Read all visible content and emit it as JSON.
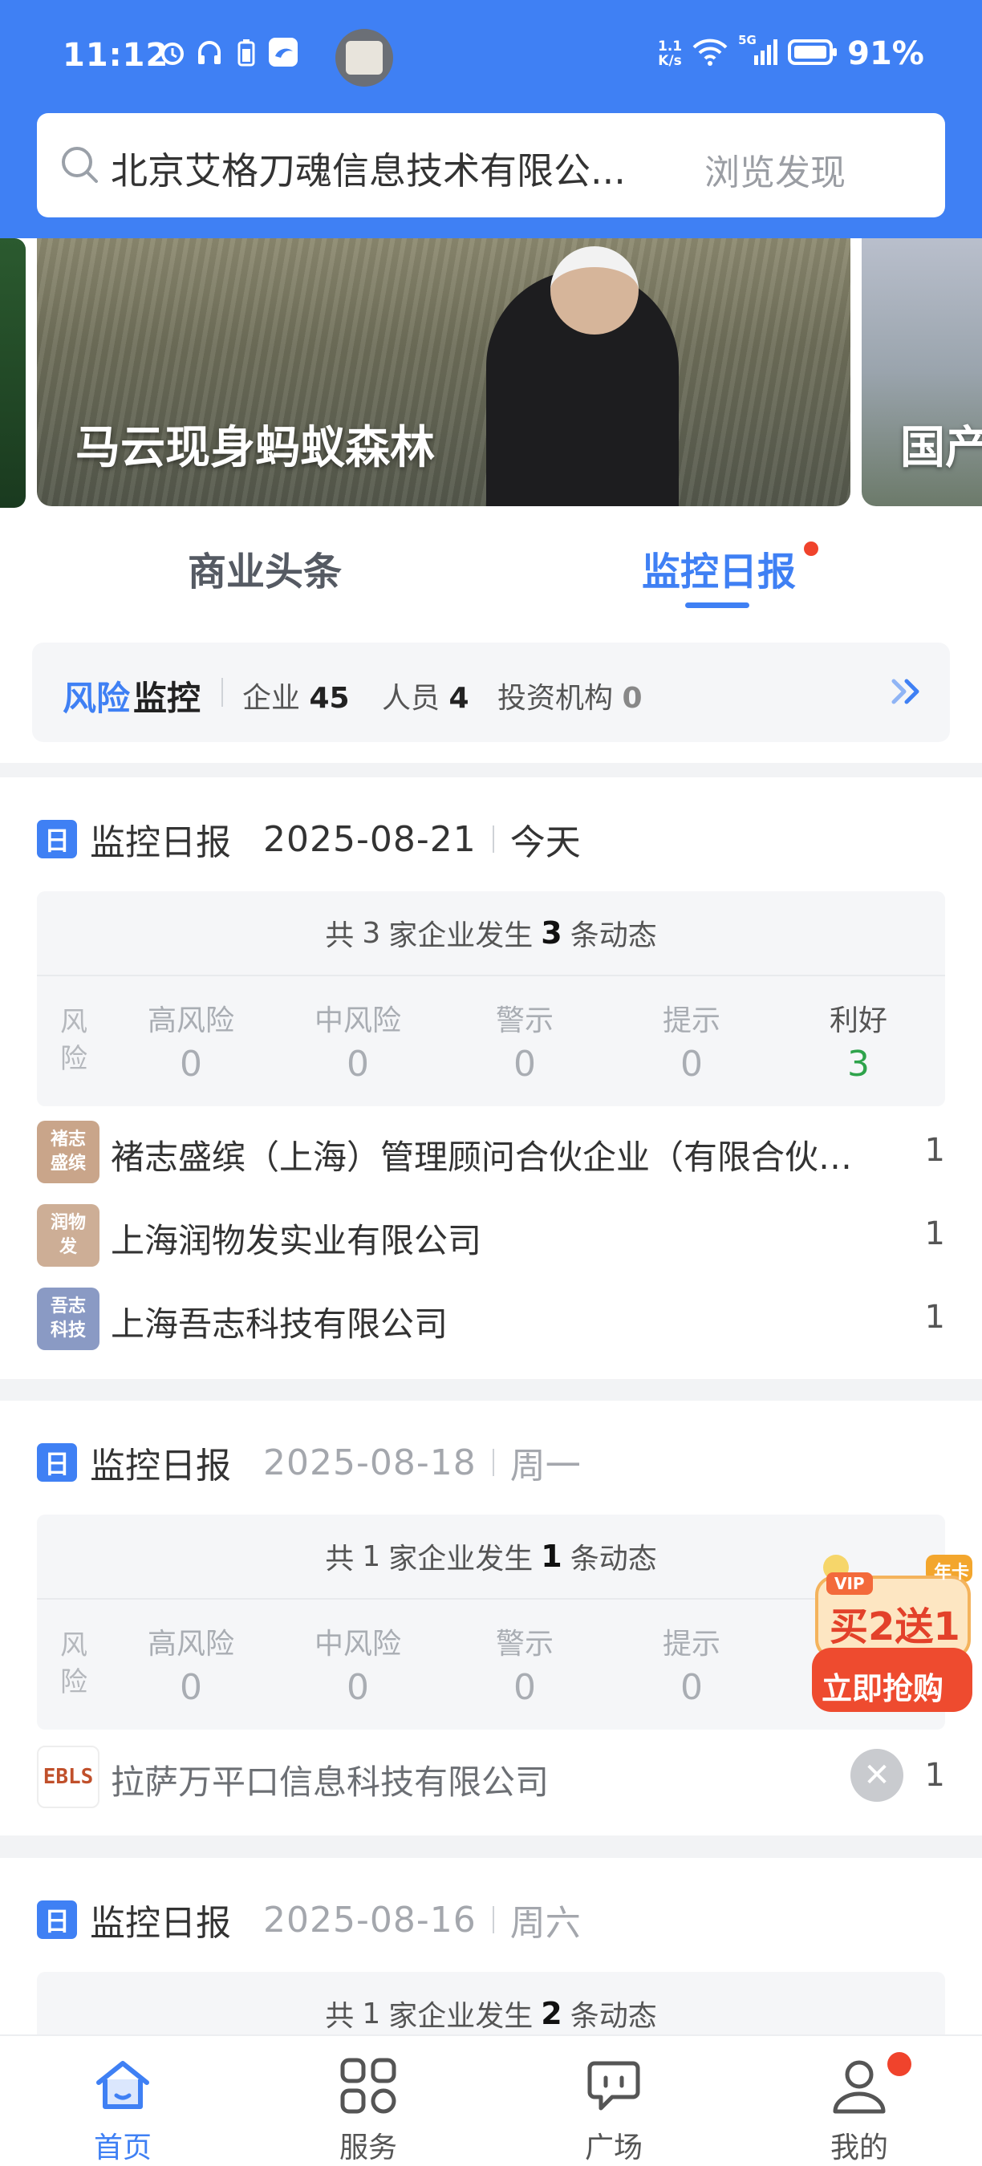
{
  "status_bar": {
    "time": "11:12",
    "net_speed": "1.1\nK/s",
    "network": "5G",
    "battery": "91%"
  },
  "search": {
    "query": "北京艾格刀魂信息技术有限公...",
    "hint": "浏览发现"
  },
  "banner": {
    "title": "马云现身蚂蚁森林",
    "next_title": "国产"
  },
  "tabs": {
    "business": "商业头条",
    "monitor": "监控日报"
  },
  "risk_monitor": {
    "title_a": "风险",
    "title_b": "监控",
    "company_label": "企业",
    "company_count": "45",
    "person_label": "人员",
    "person_count": "4",
    "investor_label": "投资机构",
    "investor_count": "0"
  },
  "risk_columns": {
    "side_label": "风险",
    "high": "高风险",
    "medium": "中风险",
    "warning": "警示",
    "notice": "提示",
    "positive": "利好"
  },
  "reports": [
    {
      "title": "监控日报",
      "date": "2025-08-21",
      "day": "今天",
      "summary_prefix": "共",
      "companies": "3",
      "summary_mid": "家企业发生",
      "events": "3",
      "summary_suffix": "条动态",
      "values": {
        "high": "0",
        "medium": "0",
        "warning": "0",
        "notice": "0",
        "positive": "3"
      },
      "items": [
        {
          "logo": "褚志\n盛缤",
          "name": "褚志盛缤（上海）管理顾问合伙企业（有限合伙…",
          "count": "1"
        },
        {
          "logo": "润物\n发",
          "name": "上海润物发实业有限公司",
          "count": "1"
        },
        {
          "logo": "吾志\n科技",
          "name": "上海吾志科技有限公司",
          "count": "1"
        }
      ]
    },
    {
      "title": "监控日报",
      "date": "2025-08-18",
      "day": "周一",
      "summary_prefix": "共",
      "companies": "1",
      "summary_mid": "家企业发生",
      "events": "1",
      "summary_suffix": "条动态",
      "values": {
        "high": "0",
        "medium": "0",
        "warning": "0",
        "notice": "0"
      },
      "items": [
        {
          "logo": "EBLS",
          "name": "拉萨万平口信息科技有限公司",
          "count": "1"
        }
      ]
    },
    {
      "title": "监控日报",
      "date": "2025-08-16",
      "day": "周六",
      "summary_prefix": "共",
      "companies": "1",
      "summary_mid": "家企业发生",
      "events": "2",
      "summary_suffix": "条动态"
    }
  ],
  "vip": {
    "tag": "年卡",
    "offer": "买2送1",
    "cta": "立即抢购",
    "badge": "VIP"
  },
  "nav": {
    "home": "首页",
    "service": "服务",
    "square": "广场",
    "mine": "我的"
  },
  "colors": {
    "primary": "#3f80f4",
    "positive": "#2ea34b",
    "alert": "#f0432c"
  }
}
